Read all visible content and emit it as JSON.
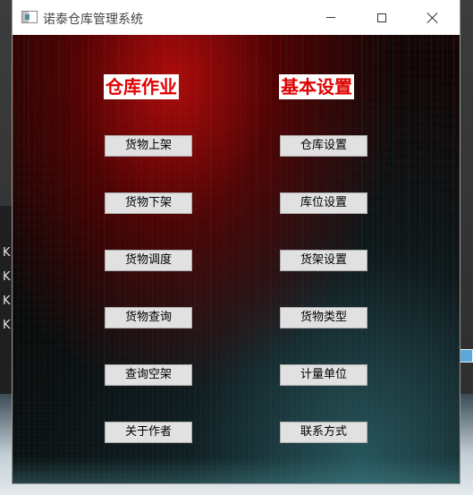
{
  "window": {
    "title": "诺泰仓库管理系统",
    "icon": "app-window-icon"
  },
  "titlebar_controls": {
    "minimize_icon": "minimize-icon",
    "maximize_icon": "maximize-icon",
    "close_icon": "close-icon"
  },
  "sections": {
    "left": {
      "header": "仓库作业",
      "buttons": [
        "货物上架",
        "货物下架",
        "货物调度",
        "货物查询",
        "查询空架",
        "关于作者"
      ]
    },
    "right": {
      "header": "基本设置",
      "buttons": [
        "仓库设置",
        "库位设置",
        "货架设置",
        "货物类型",
        "计量单位",
        "联系方式"
      ]
    }
  },
  "background_app": {
    "left_chars": [
      "K",
      "K",
      "K",
      "K"
    ]
  },
  "colors": {
    "header_text": "#e00000",
    "header_bg": "#ffffff",
    "button_bg": "#e1e1e1",
    "button_border": "#adadad"
  }
}
